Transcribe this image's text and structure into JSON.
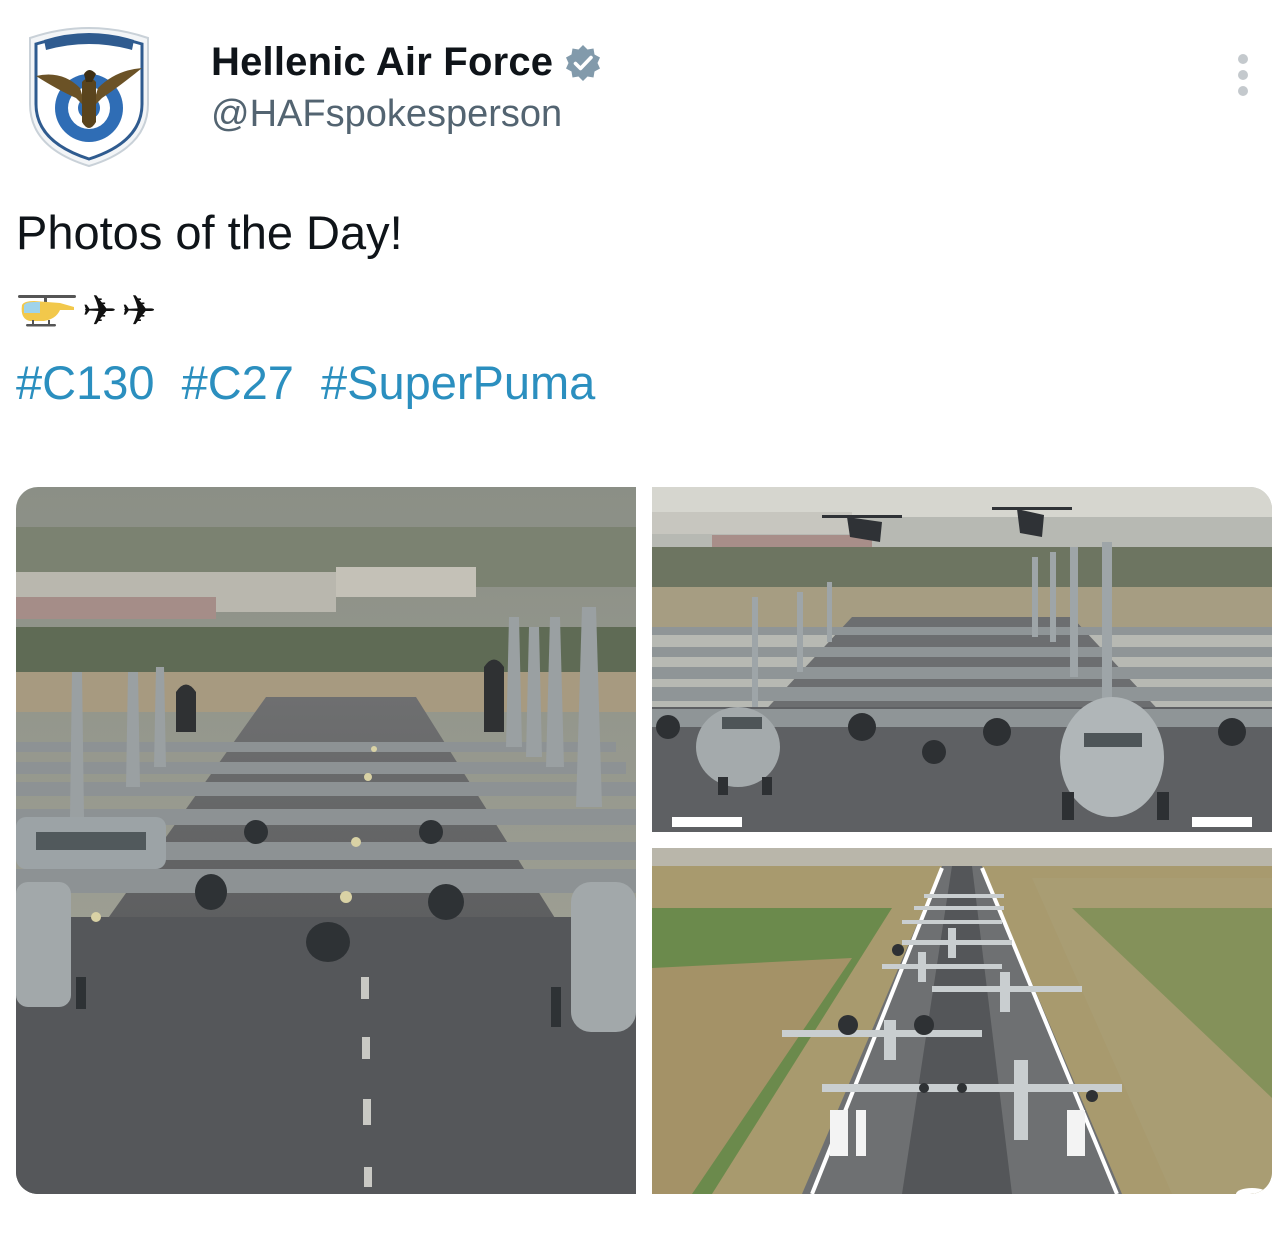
{
  "author": {
    "display_name": "Hellenic Air Force",
    "handle": "@HAFspokesperson",
    "verified": true,
    "avatar_icon": "air-force-emblem-icon"
  },
  "post": {
    "text": "Photos of the Day!",
    "emoji": [
      "helicopter-emoji",
      "airplane-emoji",
      "airplane-emoji"
    ],
    "hashtags": [
      "#C130",
      "#C27",
      "#SuperPuma"
    ]
  },
  "media": {
    "photos": [
      {
        "subject": "c130-line-ground-view"
      },
      {
        "subject": "c130-line-with-helicopters"
      },
      {
        "subject": "runway-aerial-view"
      }
    ]
  },
  "colors": {
    "hashtag": "#2b8fbf",
    "verified_badge": "#829aab",
    "handle_text": "#536471"
  }
}
